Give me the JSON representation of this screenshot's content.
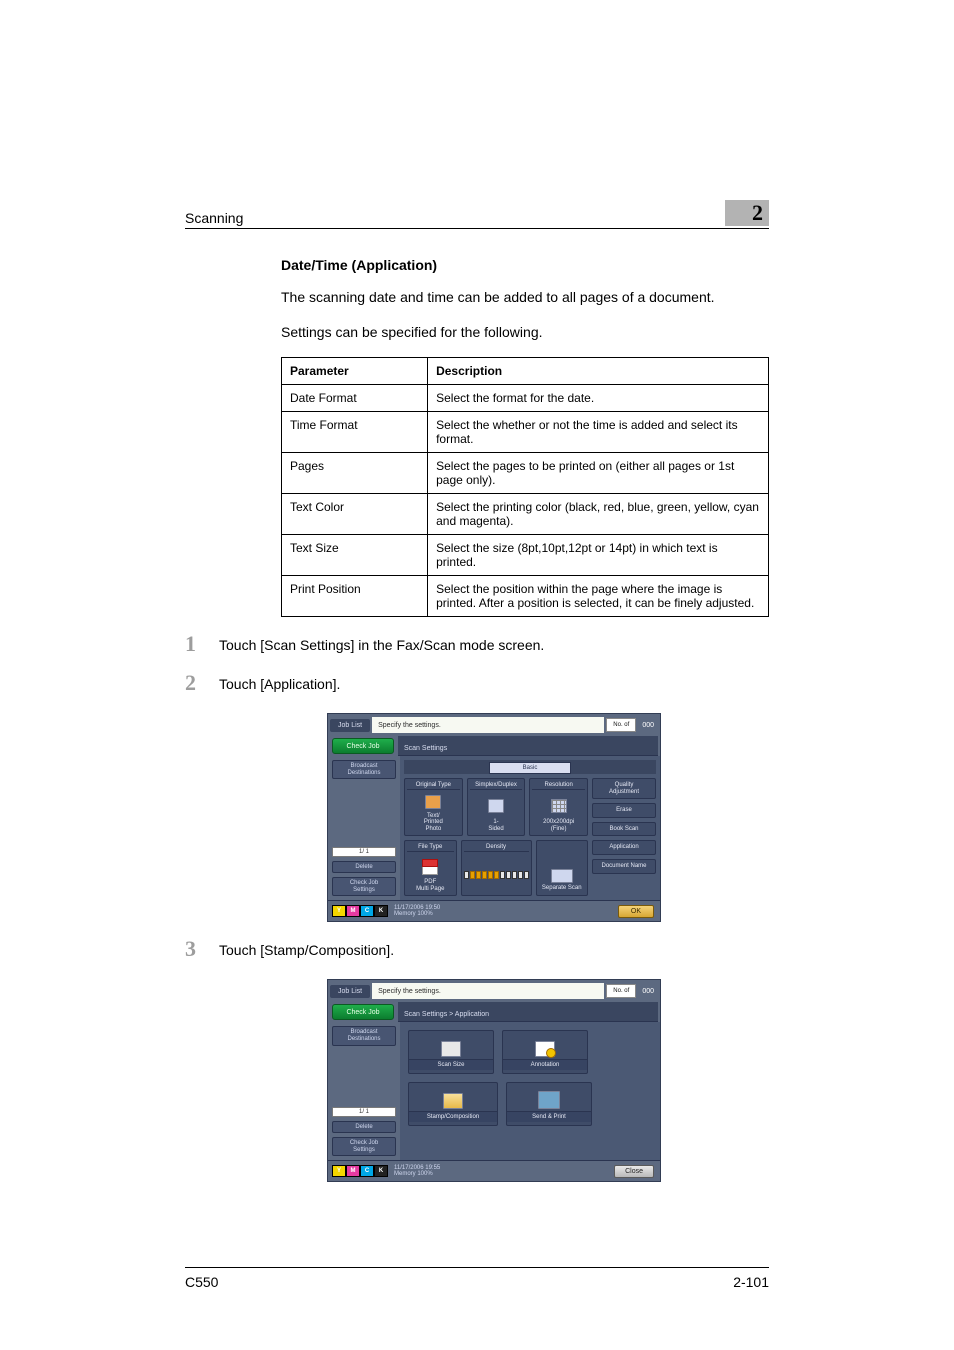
{
  "header": {
    "section": "Scanning",
    "chapter": "2"
  },
  "title": "Date/Time (Application)",
  "intro": [
    "The scanning date and time can be added to all pages of a document.",
    "Settings can be specified for the following."
  ],
  "table": {
    "headers": [
      "Parameter",
      "Description"
    ],
    "rows": [
      [
        "Date Format",
        "Select the format for the date."
      ],
      [
        "Time Format",
        "Select the whether or not the time is added and select its format."
      ],
      [
        "Pages",
        "Select the pages to be printed on (either all pages or 1st page only)."
      ],
      [
        "Text Color",
        "Select the printing color (black, red, blue, green, yellow, cyan and magenta)."
      ],
      [
        "Text Size",
        "Select the size (8pt,10pt,12pt or 14pt) in which text is printed."
      ],
      [
        "Print Position",
        "Select the position within the page where the image is printed. After a position is selected, it can be finely adjusted."
      ]
    ]
  },
  "steps": [
    {
      "n": "1",
      "text": "Touch [Scan Settings] in the Fax/Scan mode screen."
    },
    {
      "n": "2",
      "text": "Touch [Application]."
    },
    {
      "n": "3",
      "text": "Touch [Stamp/Composition]."
    }
  ],
  "screens": {
    "common": {
      "jobList": "Job List",
      "checkJob": "Check Job",
      "broadcast": "Broadcast\nDestinations",
      "pageIndicator": "1/  1",
      "delete": "Delete",
      "checkJobSettings": "Check Job\nSettings",
      "toner": [
        "Y",
        "M",
        "C",
        "K"
      ],
      "count": "000"
    },
    "s1": {
      "instruction": "Specify the settings.",
      "listBadge": "No. of",
      "breadcrumb": "Scan Settings",
      "tab": "Basic",
      "cards": {
        "originalType": "Original Type",
        "originalTypeVal": "Text/\nPrinted\nPhoto",
        "simplexDuplex": "Simplex/Duplex",
        "simplexDuplexVal": "1-\nSided",
        "resolution": "Resolution",
        "resolutionVal": "200x200dpi\n(Fine)",
        "fileType": "File Type",
        "fileTypeVal": "PDF\nMulti Page",
        "density": "Density",
        "separateScan": "Separate Scan"
      },
      "side": {
        "quality": "Quality\nAdjustment",
        "erase": "Erase",
        "bookScan": "Book Scan",
        "application": "Application",
        "docName": "Document Name"
      },
      "datetime": "11/17/2006   19:50\nMemory       100%",
      "ok": "OK"
    },
    "s2": {
      "instruction": "Specify the settings.",
      "listBadge": "No. of",
      "breadcrumb": "Scan Settings > Application",
      "apps": {
        "scanSize": "Scan Size",
        "annotation": "Annotation",
        "stamp": "Stamp/Composition",
        "send": "Send & Print"
      },
      "datetime": "11/17/2006   19:55\nMemory       100%",
      "close": "Close"
    }
  },
  "footer": {
    "model": "C550",
    "page": "2-101"
  }
}
